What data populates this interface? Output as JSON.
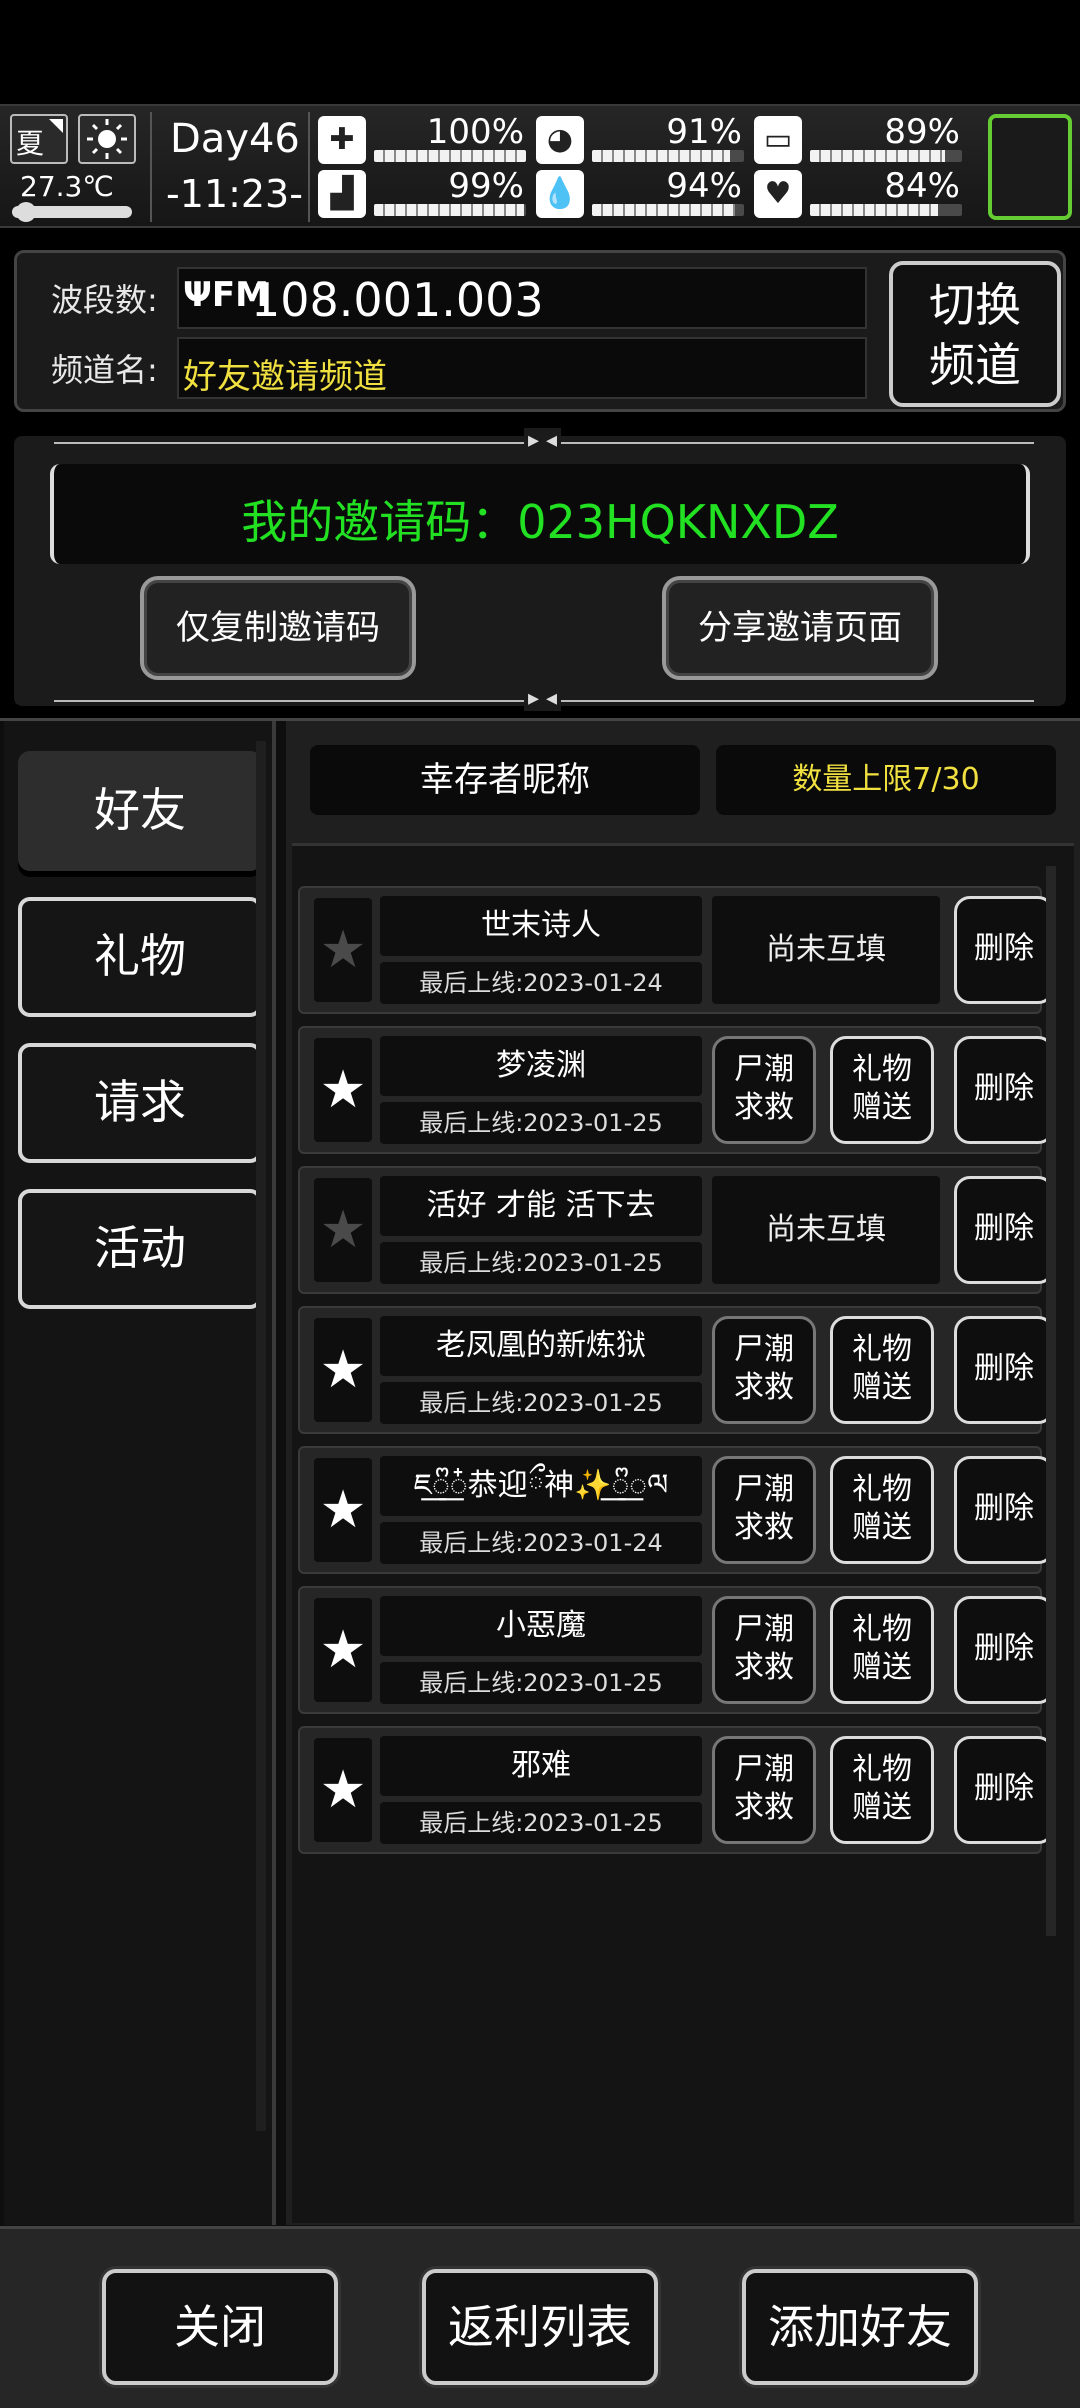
{
  "status": {
    "season": "夏",
    "temperature": "27.3℃",
    "day": "Day46",
    "time": "-11:23-",
    "stats": [
      {
        "icon": "medkit-icon",
        "glyph": "✚",
        "value": "100%",
        "level": 1.0
      },
      {
        "icon": "stomach-icon",
        "glyph": "◕",
        "value": "91%",
        "level": 0.91
      },
      {
        "icon": "pill-icon",
        "glyph": "▭",
        "value": "89%",
        "level": 0.89
      },
      {
        "icon": "boot-icon",
        "glyph": "▟",
        "value": "99%",
        "level": 0.99
      },
      {
        "icon": "water-drop-icon",
        "glyph": "💧",
        "value": "94%",
        "level": 0.94
      },
      {
        "icon": "heart-icon",
        "glyph": "♥",
        "value": "84%",
        "level": 0.84
      }
    ]
  },
  "radio": {
    "freq_label": "波段数:",
    "freq_value": "108.001.003",
    "fm_icon": "ΨFM",
    "channel_label": "频道名:",
    "channel_value": "好友邀请频道",
    "switch_button": "切换频道"
  },
  "invite": {
    "code_text": "我的邀请码：023HQKNXDZ",
    "copy_button": "仅复制邀请码",
    "share_button": "分享邀请页面"
  },
  "tabs": [
    {
      "label": "好友",
      "active": true
    },
    {
      "label": "礼物",
      "active": false
    },
    {
      "label": "请求",
      "active": false
    },
    {
      "label": "活动",
      "active": false
    }
  ],
  "list_header": {
    "name_col": "幸存者昵称",
    "limit": "数量上限7/30"
  },
  "labels": {
    "pending": "尚未互填",
    "rescue": "尸潮\n求救",
    "gift": "礼物\n赠送",
    "delete": "删除"
  },
  "friends": [
    {
      "name": "世末诗人",
      "last_online": "最后上线:2023-01-24",
      "mutual": false
    },
    {
      "name": "梦凌渊",
      "last_online": "最后上线:2023-01-25",
      "mutual": true
    },
    {
      "name": "活好 才能 活下去",
      "last_online": "最后上线:2023-01-25",
      "mutual": false
    },
    {
      "name": "老凤凰的新炼狱",
      "last_online": "最后上线:2023-01-25",
      "mutual": true
    },
    {
      "name": "ཇ꯭ᩚ꯭໋恭迎ྀ神✨꯭ᩚ꯭ལ",
      "last_online": "最后上线:2023-01-24",
      "mutual": true
    },
    {
      "name": "小惡魔",
      "last_online": "最后上线:2023-01-25",
      "mutual": true
    },
    {
      "name": "邪难",
      "last_online": "最后上线:2023-01-25",
      "mutual": true
    }
  ],
  "bottom": {
    "close": "关闭",
    "rebate": "返利列表",
    "add_friend": "添加好友"
  }
}
